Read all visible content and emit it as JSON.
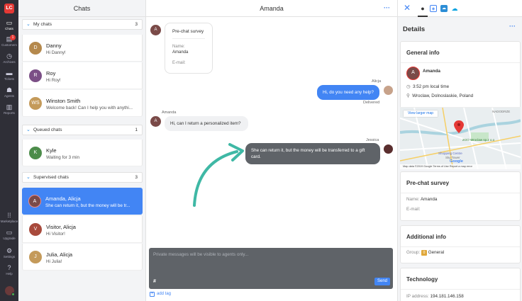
{
  "nav": {
    "logo": "LC",
    "items": [
      {
        "label": "Chats",
        "icon": "chat-icon"
      },
      {
        "label": "Customers",
        "icon": "customers-icon",
        "badge": "1"
      },
      {
        "label": "Archives",
        "icon": "archives-icon"
      },
      {
        "label": "Tickets",
        "icon": "tickets-icon"
      },
      {
        "label": "Agents",
        "icon": "agents-icon"
      },
      {
        "label": "Reports",
        "icon": "reports-icon"
      },
      {
        "label": "Marketplace",
        "icon": "marketplace-icon"
      },
      {
        "label": "Upgrade",
        "icon": "upgrade-icon"
      },
      {
        "label": "Settings",
        "icon": "settings-icon"
      },
      {
        "label": "Help",
        "icon": "help-icon"
      }
    ]
  },
  "chats": {
    "title": "Chats",
    "sections": [
      {
        "label": "My chats",
        "count": "3"
      },
      {
        "label": "Queued chats",
        "count": "1"
      },
      {
        "label": "Supervised chats",
        "count": "3"
      }
    ],
    "items": [
      {
        "initial": "D",
        "name": "Danny",
        "preview": "Hi Danny!",
        "color": "#b5894d"
      },
      {
        "initial": "R",
        "name": "Roy",
        "preview": "Hi Roy!",
        "color": "#7b4f86"
      },
      {
        "initial": "WS",
        "name": "Winston Smith",
        "preview": "Welcome back! Can I help you with anythi...",
        "color": "#c49a5a"
      },
      {
        "initial": "K",
        "name": "Kyle",
        "preview": "Waiting for 3 min",
        "color": "#4c8c4a"
      },
      {
        "initial": "A",
        "name": "Amanda, Alicja",
        "preview": "She can return it, but the money will be tr...",
        "color": "#7a4a48"
      },
      {
        "initial": "V",
        "name": "Visitor, Alicja",
        "preview": "Hi Visitor!",
        "color": "#a84a3c"
      },
      {
        "initial": "J",
        "name": "Julia, Alicja",
        "preview": "Hi Julia!",
        "color": "#c49a5a"
      }
    ]
  },
  "conversation": {
    "title": "Amanda",
    "survey": {
      "title": "Pre-chat survey",
      "name_label": "Name:",
      "name_value": "Amanda",
      "email_label": "E-mail:",
      "avatar": "A"
    },
    "messages": [
      {
        "author": "Alicja",
        "text": "Hi, do you need any help?",
        "status": "Delivered"
      },
      {
        "author": "Amanda",
        "text": "Hi, can I return a personalized item?",
        "avatar": "A"
      },
      {
        "author": "Jessica",
        "text_line1": "She can return it, but the money will be transferred to a gift",
        "text_line2": "card."
      }
    ],
    "composer": {
      "placeholder": "Private messages will be visible to agents only...",
      "hash": "#",
      "send": "Send"
    },
    "add_tag": "add tag"
  },
  "details": {
    "title": "Details",
    "general": {
      "title": "General info",
      "initial": "A",
      "name": "Amanda",
      "local_time": "3:52 pm local time",
      "location": "Wroclaw, Dolnoslaskie, Poland",
      "map_button": "View larger map",
      "map_labels": [
        "NADODRZE",
        "ZOO Wroclaw sp.z o.o",
        "Shopping Centre",
        "Sky Tower",
        "Google"
      ],
      "map_footer": "Map data ©2019 Google   Terms of Use   Report a map error"
    },
    "prechat": {
      "title": "Pre-chat survey",
      "name_label": "Name:",
      "name_value": "Amanda",
      "email_label": "E-mail:"
    },
    "additional": {
      "title": "Additional info",
      "group_label": "Group:",
      "group_badge": "0",
      "group_value": "General"
    },
    "technology": {
      "title": "Technology",
      "ip_label": "IP address:",
      "ip_value": "194.181.146.158"
    }
  },
  "colors": {
    "accent": "#4285f4",
    "nav_bg": "#2f2f37",
    "dark_bubble": "#5f6368",
    "arrow": "#3fb8a5"
  }
}
